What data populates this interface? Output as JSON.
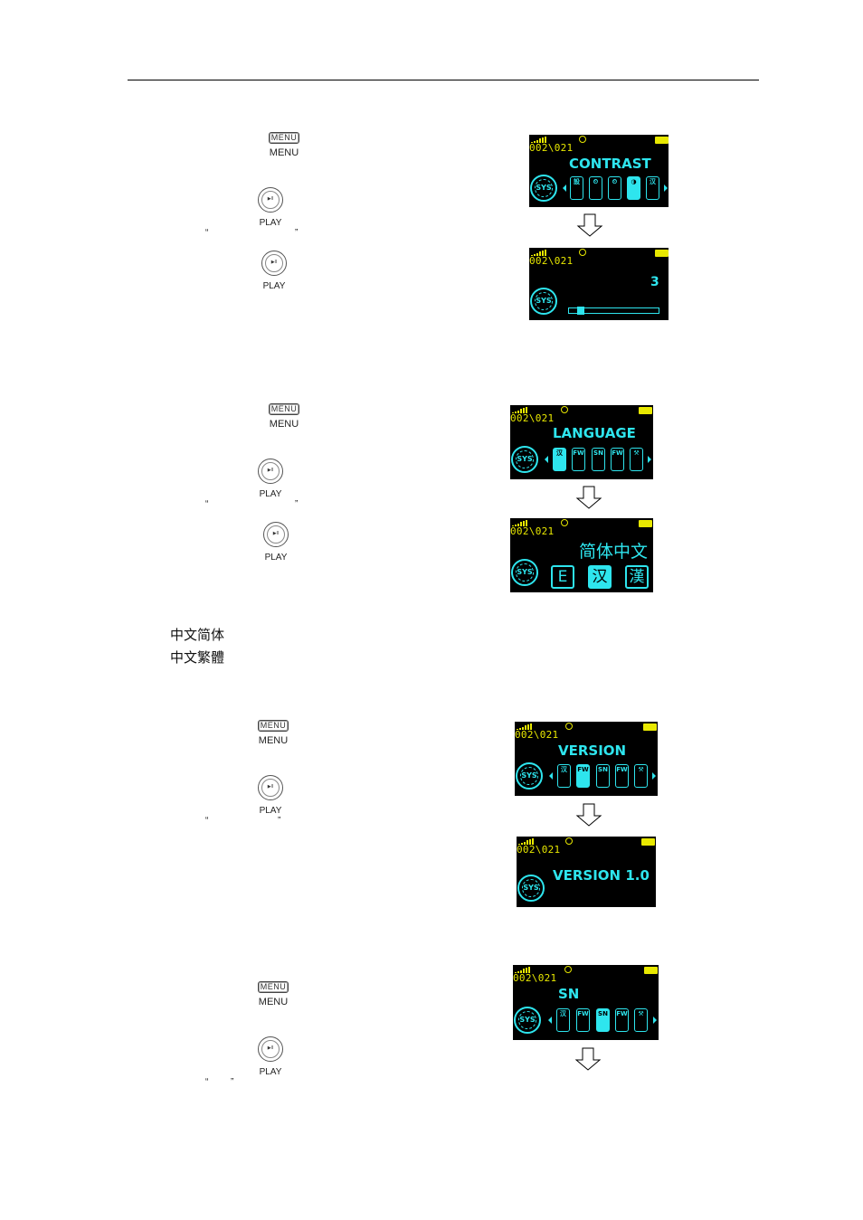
{
  "buttons": {
    "menu_key": "MENU",
    "menu_label": "MENU",
    "play_glyph": "▶II",
    "play_label": "PLAY"
  },
  "quotes": {
    "open": "“",
    "close": "”"
  },
  "status_bar": {
    "track": "002\\021"
  },
  "sys_label": "SYS",
  "sections": {
    "contrast": {
      "menu_title": "CONTRAST",
      "menu_icons": [
        "設",
        "⏲",
        "⏲",
        "◑",
        "汉"
      ],
      "selected_icon_index": 3,
      "value": "3",
      "slider_fraction": 0.1
    },
    "language": {
      "menu_title": "LANGUAGE",
      "menu_icons": [
        "汉",
        "FW",
        "SN",
        "FW",
        "⚒"
      ],
      "selected_icon_index": 0,
      "current_language": "简体中文",
      "options": [
        "E",
        "汉",
        "漢"
      ],
      "selected_option_index": 1
    },
    "language_notes": [
      "中文简体",
      "中文繁體"
    ],
    "version": {
      "menu_title": "VERSION",
      "menu_icons": [
        "汉",
        "FW",
        "SN",
        "FW",
        "⚒"
      ],
      "selected_icon_index": 1,
      "result": "VERSION 1.0"
    },
    "sn": {
      "menu_title": "SN",
      "menu_icons": [
        "汉",
        "FW",
        "SN",
        "FW",
        "⚒"
      ],
      "selected_icon_index": 2
    }
  }
}
